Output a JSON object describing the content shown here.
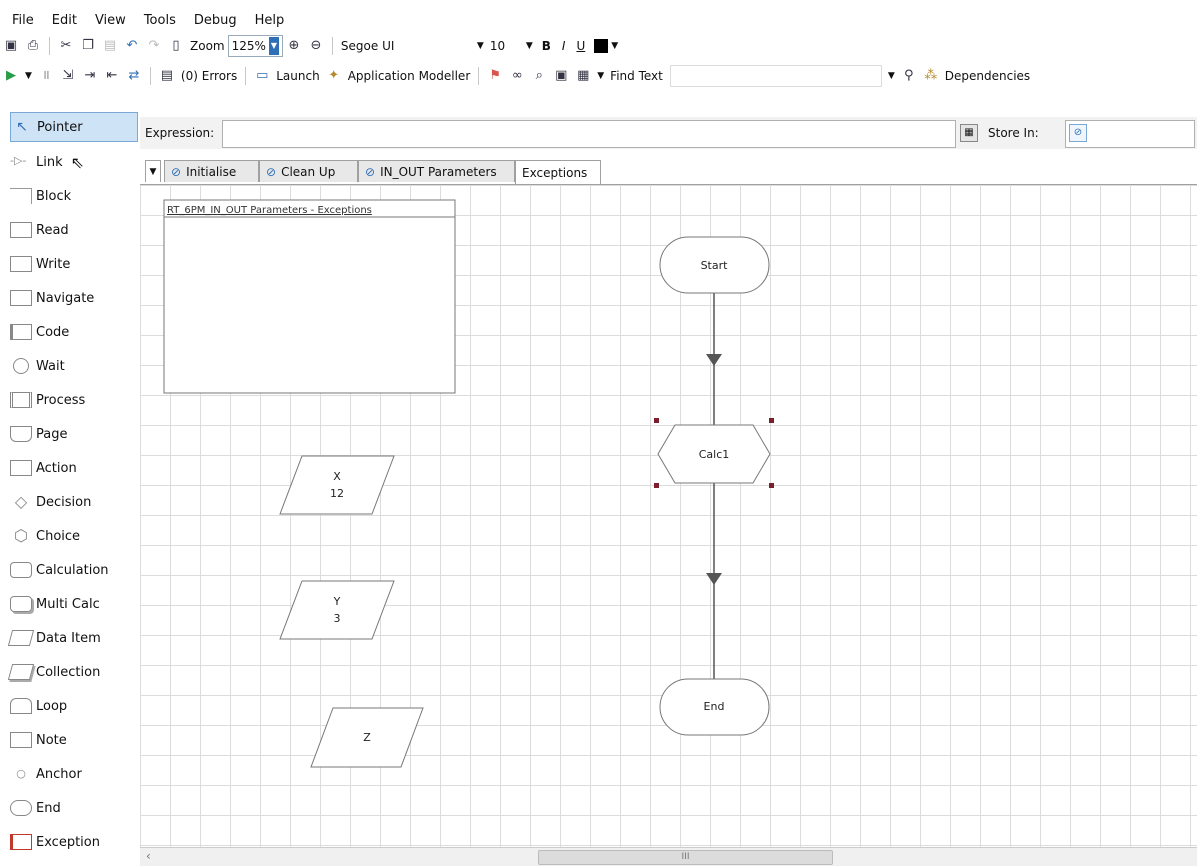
{
  "menu": [
    "File",
    "Edit",
    "View",
    "Tools",
    "Debug",
    "Help"
  ],
  "toolbar1": {
    "zoom_label": "Zoom",
    "zoom_value": "125%",
    "font_name": "Segoe UI",
    "font_size": "10",
    "bold": "B",
    "italic": "I",
    "underline": "U"
  },
  "toolbar2": {
    "errors": "(0) Errors",
    "launch": "Launch",
    "app_modeller": "Application Modeller",
    "find_text": "Find Text",
    "dependencies": "Dependencies"
  },
  "tools": [
    "Pointer",
    "Link",
    "Block",
    "Read",
    "Write",
    "Navigate",
    "Code",
    "Wait",
    "Process",
    "Page",
    "Action",
    "Decision",
    "Choice",
    "Calculation",
    "Multi Calc",
    "Data Item",
    "Collection",
    "Loop",
    "Note",
    "Anchor",
    "End",
    "Exception"
  ],
  "expression": {
    "label": "Expression:",
    "value": "",
    "store_in_label": "Store In:"
  },
  "tabs": [
    "Initialise",
    "Clean Up",
    "IN_OUT Parameters",
    "Exceptions"
  ],
  "active_tab": "Exceptions",
  "canvas": {
    "info_box_title": "RT_6PM_IN_OUT Parameters - Exceptions",
    "start": "Start",
    "calc": "Calc1",
    "end": "End",
    "x_name": "X",
    "x_value": "12",
    "y_name": "Y",
    "y_value": "3",
    "z_name": "Z"
  },
  "scroll": {
    "thumb_label": "III",
    "left_arrow": "‹"
  },
  "colors": {
    "accent": "#2f6fb5",
    "selected_tool": "#cfe3f7",
    "exception": "#c0392b"
  }
}
